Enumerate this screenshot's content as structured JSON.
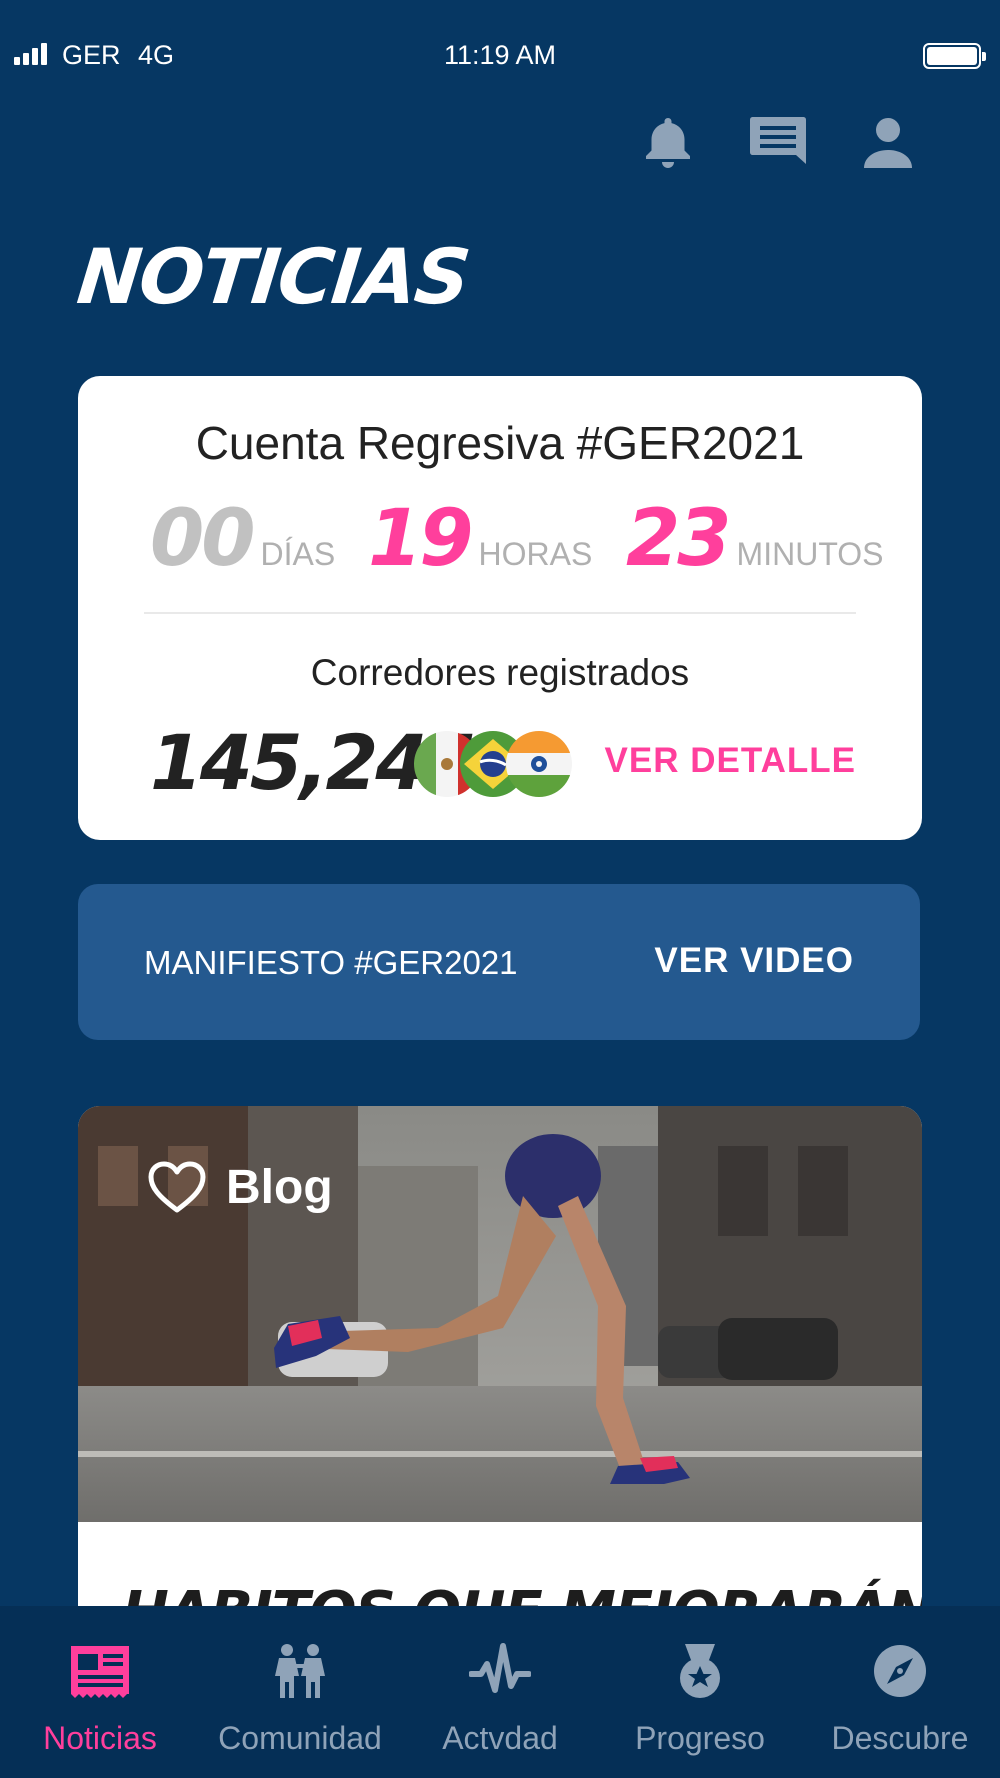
{
  "status_bar": {
    "carrier": "GER",
    "network": "4G",
    "time": "11:19 AM"
  },
  "header": {
    "icons": [
      "bell-icon",
      "chat-icon",
      "user-icon"
    ]
  },
  "page_title": "NOTICIAS",
  "countdown_card": {
    "title": "Cuenta Regresiva #GER2021",
    "days_value": "00",
    "days_unit": "DÍAS",
    "hours_value": "19",
    "hours_unit": "HORAS",
    "minutes_value": "23",
    "minutes_unit": "MINUTOS",
    "registered_label": "Corredores registrados",
    "registered_count": "145,244",
    "action_label": "VER DETALLE"
  },
  "manifesto": {
    "label": "MANIFIESTO #GER2021",
    "action_label": "VER VIDEO"
  },
  "blog_card": {
    "label": "Blog",
    "headline": "HABITOS QUE MEJORARÁN TU"
  },
  "bottom_nav": {
    "items": [
      {
        "label": "Noticias",
        "icon": "newspaper-icon",
        "active": true
      },
      {
        "label": "Comunidad",
        "icon": "people-icon",
        "active": false
      },
      {
        "label": "Actvdad",
        "icon": "activity-icon",
        "active": false
      },
      {
        "label": "Progreso",
        "icon": "medal-icon",
        "active": false
      },
      {
        "label": "Descubre",
        "icon": "compass-icon",
        "active": false
      }
    ]
  },
  "colors": {
    "background": "#063763",
    "accent_pink": "#ff3f9c",
    "bar_blue": "#24598f",
    "nav_bg": "#052f56",
    "icon_muted": "#8fa3b8"
  }
}
